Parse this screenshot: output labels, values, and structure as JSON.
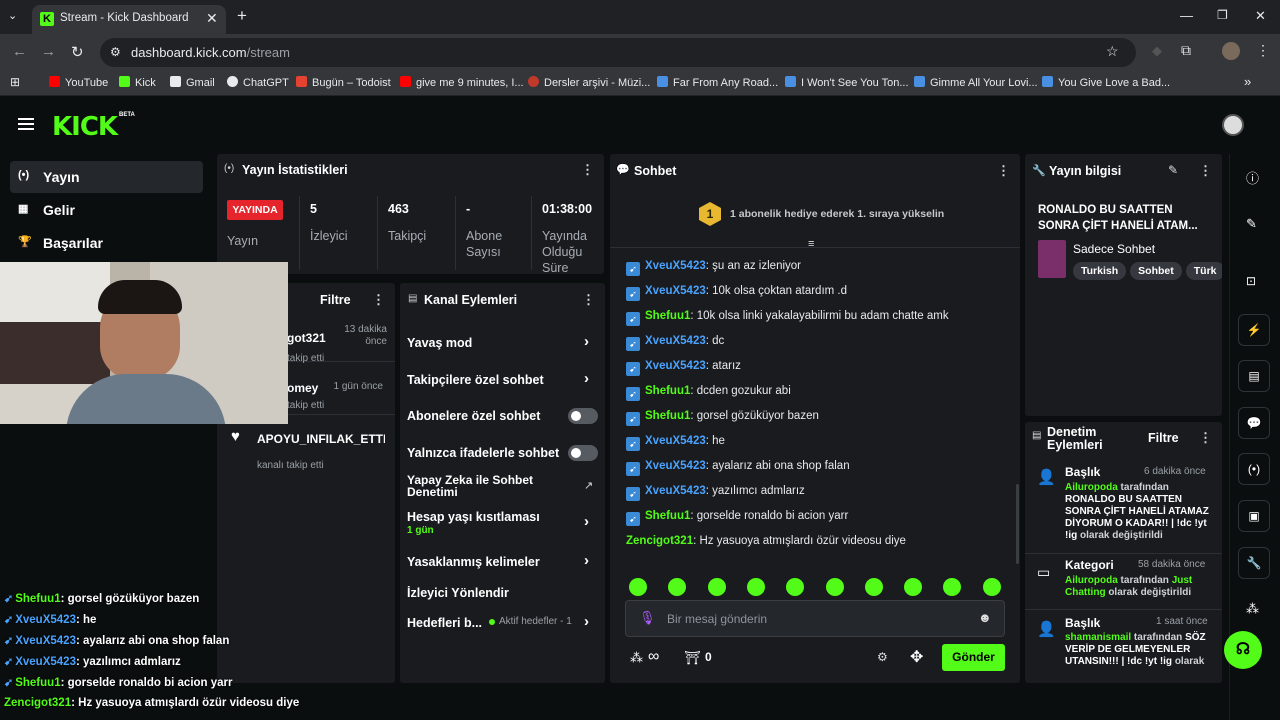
{
  "browser": {
    "tab_title": "Stream - Kick Dashboard",
    "url_host": "dashboard.kick.com",
    "url_path": "/stream",
    "bookmarks": [
      "YouTube",
      "Kick",
      "Gmail",
      "ChatGPT",
      "Bugün – Todoist",
      "give me 9 minutes, I...",
      "Dersler arşivi - Müzi...",
      "Far From Any Road...",
      "I Won't See You Ton...",
      "Gimme All Your Lovi...",
      "You Give Love a Bad..."
    ]
  },
  "app": {
    "logo": "KICK",
    "beta": "BETA"
  },
  "sidebar": {
    "items": [
      {
        "label": "Yayın",
        "icon": "broadcast-icon"
      },
      {
        "label": "Gelir",
        "icon": "revenue-icon"
      },
      {
        "label": "Başarılar",
        "icon": "trophy-icon"
      }
    ]
  },
  "stats": {
    "title": "Yayın İstatistikleri",
    "live_badge": "YAYINDA",
    "live_label": "Yayın",
    "cols": [
      {
        "value": "5",
        "label": "İzleyici"
      },
      {
        "value": "463",
        "label": "Takipçi"
      },
      {
        "value": "-",
        "label": "Abone Sayısı"
      },
      {
        "value": "01:38:00",
        "label": "Yayında Olduğu Süre"
      }
    ]
  },
  "activity": {
    "filter": "Filtre",
    "items": [
      {
        "name": "got321",
        "time": "13 dakika önce",
        "sub": "takip etti"
      },
      {
        "name": "omey",
        "time": "1 gün önce",
        "sub": "takip etti"
      },
      {
        "name": "APOYU_INFILAK_ETTI",
        "time": "",
        "sub": "kanalı takip etti"
      }
    ]
  },
  "channel_actions": {
    "title": "Kanal Eylemleri",
    "items": [
      {
        "label": "Yavaş mod"
      },
      {
        "label": "Takipçilere özel sohbet"
      },
      {
        "label": "Abonelere özel sohbet"
      },
      {
        "label": "Yalnızca ifadelerle sohbet"
      },
      {
        "label": "Yapay Zeka ile Sohbet Denetimi"
      },
      {
        "label": "Hesap yaşı kısıtlaması",
        "sub": "1 gün"
      },
      {
        "label": "Yasaklanmış kelimeler"
      },
      {
        "label": "İzleyici Yönlendir"
      },
      {
        "label": "Hedefleri b...",
        "sub": "Aktif hedefler - 1"
      }
    ]
  },
  "chat": {
    "title": "Sohbet",
    "banner": "1 abonelik hediye ederek 1. sıraya yükselin",
    "banner_num": "1",
    "messages": [
      {
        "user": "XveuX5423",
        "text": "şu an az izleniyor",
        "color": "blue"
      },
      {
        "user": "XveuX5423",
        "text": "10k olsa çoktan atardım .d",
        "color": "blue"
      },
      {
        "user": "Shefuu1",
        "text": "10k olsa linki yakalayabilirmi bu adam chatte amk",
        "color": "green"
      },
      {
        "user": "XveuX5423",
        "text": "dc",
        "color": "blue"
      },
      {
        "user": "XveuX5423",
        "text": "atarız",
        "color": "blue"
      },
      {
        "user": "Shefuu1",
        "text": "dcden gozukur abi",
        "color": "green"
      },
      {
        "user": "Shefuu1",
        "text": "gorsel gözüküyor bazen",
        "color": "green"
      },
      {
        "user": "XveuX5423",
        "text": "he",
        "color": "blue"
      },
      {
        "user": "XveuX5423",
        "text": "ayalarız abi ona shop falan",
        "color": "blue"
      },
      {
        "user": "XveuX5423",
        "text": "yazılımcı admlarız",
        "color": "blue"
      },
      {
        "user": "Shefuu1",
        "text": "gorselde ronaldo bi acion yarr",
        "color": "green"
      },
      {
        "user": "Zencigot321",
        "text": "Hz yasuoya atmışlardı özür videosu diye",
        "color": "green"
      }
    ],
    "input_placeholder": "Bir mesaj gönderin",
    "points": "∞",
    "gift_count": "0",
    "send": "Gönder"
  },
  "stream_info": {
    "title": "Yayın bilgisi",
    "stream_title": "RONALDO BU SAATTEN SONRA ÇİFT HANELİ ATAM...",
    "category": "Sadece Sohbet",
    "tags": [
      "Turkish",
      "Sohbet",
      "Türk"
    ]
  },
  "mod": {
    "title": "Denetim Eylemleri",
    "filter": "Filtre",
    "items": [
      {
        "kind": "Başlık",
        "time": "6 dakika önce",
        "user": "Ailuropoda",
        "mid": " tarafından ",
        "value": "RONALDO BU SAATTEN SONRA ÇİFT HANELİ ATAMAZ DİYORUM O KADAR!! | !dc !yt !ig",
        "tail": " olarak değiştirildi"
      },
      {
        "kind": "Kategori",
        "time": "58 dakika önce",
        "user": "Ailuropoda",
        "mid": " tarafından ",
        "value": "Just Chatting",
        "tail": " olarak değiştirildi"
      },
      {
        "kind": "Başlık",
        "time": "1 saat önce",
        "user": "shamanismail",
        "mid": " tarafından ",
        "value": "SÖZ VERİP DE GELMEYENLER UTANSIN!!! | !dc !yt !ig",
        "tail": " olarak"
      }
    ]
  },
  "overlay_chat": [
    {
      "user": "Shefuu1",
      "text": "gorsel gözüküyor bazen",
      "color": "green"
    },
    {
      "user": "XveuX5423",
      "text": "he",
      "color": "blue"
    },
    {
      "user": "XveuX5423",
      "text": "ayalarız abi ona shop falan",
      "color": "blue"
    },
    {
      "user": "XveuX5423",
      "text": "yazılımcı admlarız",
      "color": "blue"
    },
    {
      "user": "Shefuu1",
      "text": "gorselde ronaldo bi acion yarr",
      "color": "green"
    },
    {
      "user": "Zencigot321",
      "text": "Hz yasuoya atmışlardı özür videosu diye",
      "color": "green"
    }
  ],
  "colors": {
    "brand": "#53fc18",
    "live": "#e5252b",
    "panel": "#191b1f"
  }
}
